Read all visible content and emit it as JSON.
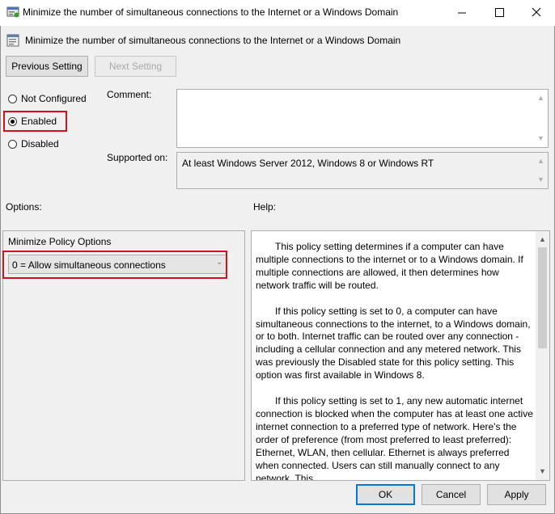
{
  "window": {
    "title": "Minimize the number of simultaneous connections to the Internet or a Windows Domain"
  },
  "header": {
    "policy_title": "Minimize the number of simultaneous connections to the Internet or a Windows Domain"
  },
  "nav": {
    "previous_label": "Previous Setting",
    "next_label": "Next Setting"
  },
  "state": {
    "not_configured": "Not Configured",
    "enabled": "Enabled",
    "disabled": "Disabled",
    "selected": "Enabled"
  },
  "comment": {
    "label": "Comment:",
    "value": ""
  },
  "supported": {
    "label": "Supported on:",
    "value": "At least Windows Server 2012, Windows 8 or Windows RT"
  },
  "options": {
    "section_label": "Options:",
    "group_label": "Minimize Policy Options",
    "dropdown_value": "0 = Allow simultaneous connections"
  },
  "help": {
    "section_label": "Help:",
    "paragraphs": [
      "This policy setting determines if a computer can have multiple connections to the internet or to a Windows domain. If multiple connections are allowed, it then determines how network traffic will be routed.",
      "If this policy setting is set to 0, a computer can have simultaneous connections to the internet, to a Windows domain, or to both. Internet traffic can be routed over any connection - including a cellular connection and any metered network. This was previously the Disabled state for this policy setting. This option was first available in Windows 8.",
      "If this policy setting is set to 1, any new automatic internet connection is blocked when the computer has at least one active internet connection to a preferred type of network. Here's the order of preference (from most preferred to least preferred): Ethernet, WLAN, then cellular. Ethernet is always preferred when connected. Users can still manually connect to any network. This"
    ]
  },
  "footer": {
    "ok_label": "OK",
    "cancel_label": "Cancel",
    "apply_label": "Apply"
  },
  "colors": {
    "highlight": "#d0131b",
    "focus_border": "#0078d7"
  }
}
